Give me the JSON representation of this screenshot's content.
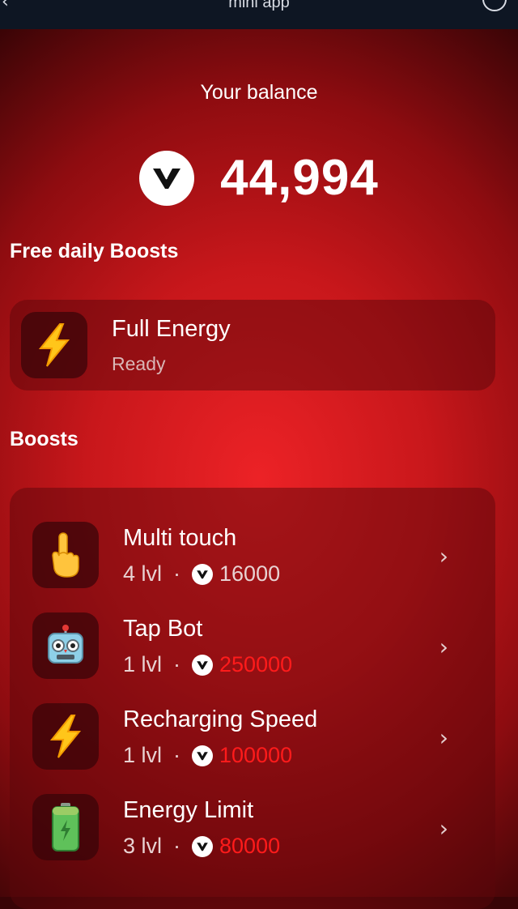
{
  "app": {
    "title": "mini app"
  },
  "balance": {
    "label": "Your balance",
    "value": "44,994"
  },
  "free_section": {
    "title": "Free daily Boosts",
    "items": [
      {
        "icon": "lightning-icon",
        "title": "Full Energy",
        "status": "Ready"
      }
    ]
  },
  "boosts_section": {
    "title": "Boosts",
    "items": [
      {
        "icon": "pointing-hand-icon",
        "title": "Multi touch",
        "level": "4 lvl",
        "price": "16000",
        "affordable": true
      },
      {
        "icon": "robot-icon",
        "title": "Tap Bot",
        "level": "1 lvl",
        "price": "250000",
        "affordable": false
      },
      {
        "icon": "lightning-icon",
        "title": "Recharging Speed",
        "level": "1 lvl",
        "price": "100000",
        "affordable": false
      },
      {
        "icon": "battery-icon",
        "title": "Energy Limit",
        "level": "3 lvl",
        "price": "80000",
        "affordable": false
      }
    ]
  },
  "colors": {
    "accent_red": "#ff1b1b",
    "background": "#c8171b"
  }
}
